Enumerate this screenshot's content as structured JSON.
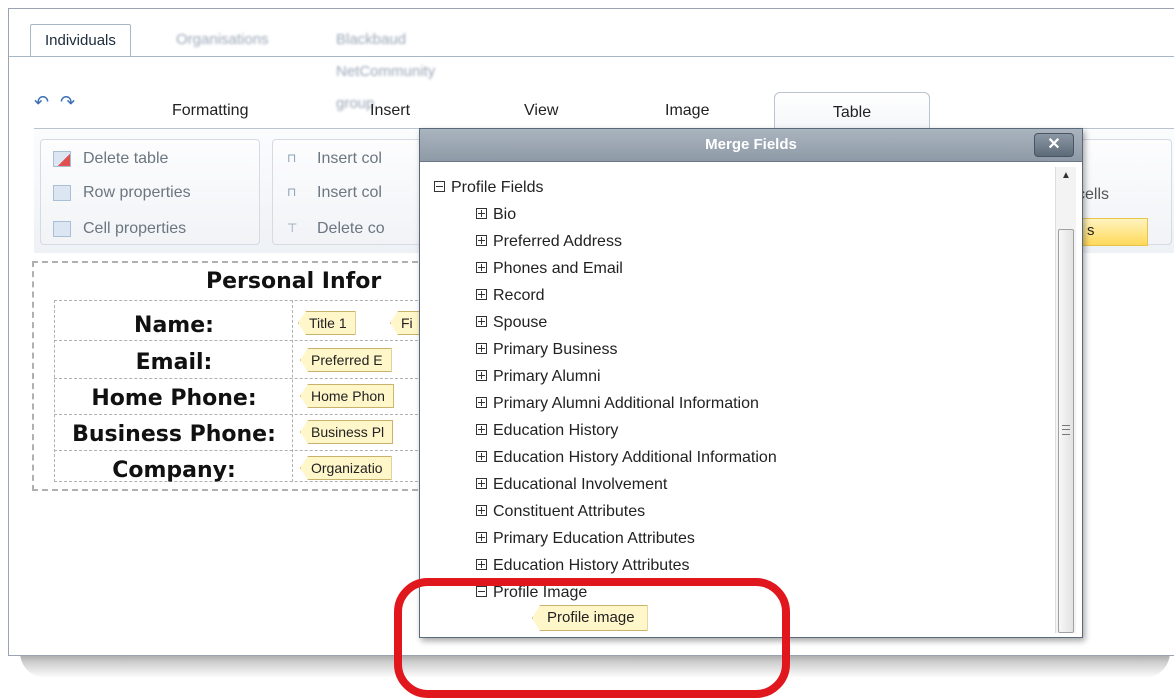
{
  "top_tabs": {
    "active": "Individuals",
    "others": [
      "Organisations",
      "Blackbaud NetCommunity group"
    ]
  },
  "ribbon": {
    "undo_icon": "undo-icon",
    "redo_icon": "redo-icon",
    "tabs": [
      "Formatting",
      "Insert",
      "View",
      "Image",
      "Table"
    ],
    "active_tab": "Table",
    "table_group": [
      "Delete table",
      "Row properties",
      "Cell properties"
    ],
    "insert_group": [
      "Insert col",
      "Insert col",
      "Delete co"
    ],
    "merge_cells_label": "cells",
    "yellow_label": "s"
  },
  "document": {
    "title": "Personal Infor",
    "rows": [
      {
        "label": "Name:",
        "tags": [
          "Title 1",
          "Fi"
        ]
      },
      {
        "label": "Email:",
        "tags": [
          "Preferred E"
        ]
      },
      {
        "label": "Home Phone:",
        "tags": [
          "Home Phon"
        ]
      },
      {
        "label": "Business Phone:",
        "tags": [
          "Business Pl"
        ]
      },
      {
        "label": "Company:",
        "tags": [
          "Organizatio"
        ]
      }
    ]
  },
  "dialog": {
    "title": "Merge Fields",
    "close_label": "✕",
    "root": "Profile Fields",
    "children": [
      "Bio",
      "Preferred Address",
      "Phones and Email",
      "Record",
      "Spouse",
      "Primary Business",
      "Primary Alumni",
      "Primary Alumni Additional Information",
      "Education History",
      "Education History Additional Information",
      "Educational Involvement",
      "Constituent Attributes",
      "Primary Education Attributes",
      "Education History Attributes"
    ],
    "expanded_node": "Profile Image",
    "expanded_child": "Profile image"
  },
  "colors": {
    "highlight_ring": "#e0171d",
    "tag_fill": "#fff6c9",
    "ribbon_accent": "#ffd95a"
  }
}
